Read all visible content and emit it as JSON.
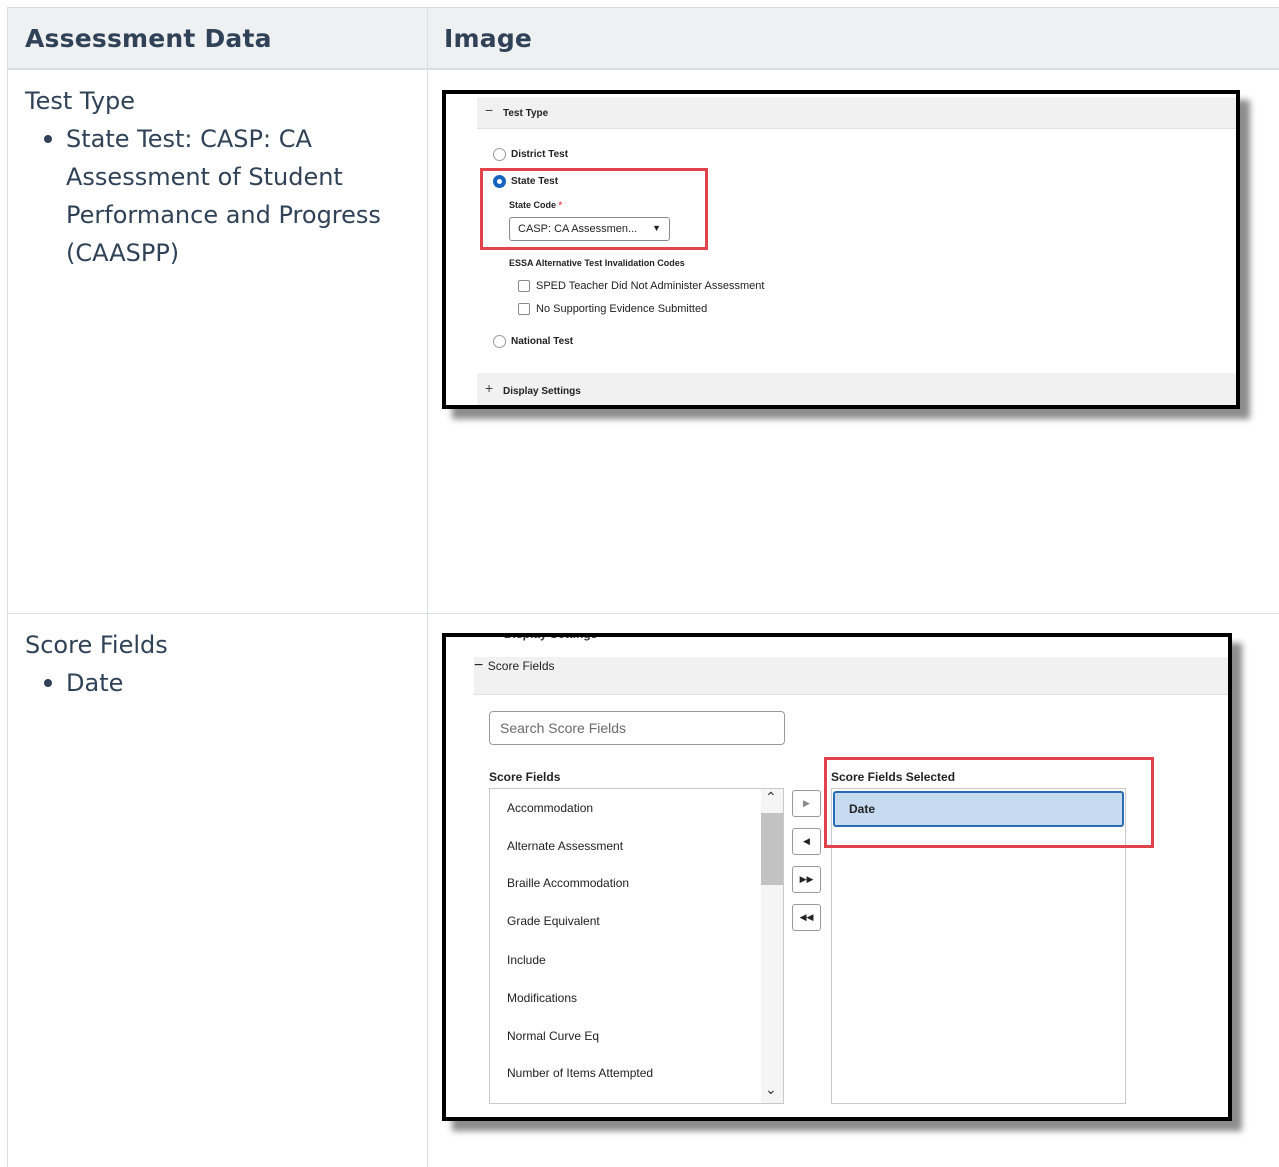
{
  "table": {
    "headers": {
      "col1": "Assessment Data",
      "col2": "Image"
    },
    "rows": [
      {
        "title": "Test Type",
        "bullets": [
          "State Test: CASP: CA Assessment of Student Performance and Progress (CAASPP)"
        ]
      },
      {
        "title": "Score Fields",
        "bullets": [
          "Date"
        ]
      }
    ]
  },
  "shot1": {
    "section_title": "Test Type",
    "radio_district": "District Test",
    "radio_state": "State Test",
    "state_code_label": "State Code",
    "required_mark": "*",
    "state_code_value": "CASP: CA Assessmen...",
    "essa_heading": "ESSA Alternative Test Invalidation Codes",
    "check_sped": "SPED Teacher Did Not Administer Assessment",
    "check_evidence": "No Supporting Evidence Submitted",
    "radio_national": "National Test",
    "display_settings": "Display Settings",
    "accent_color": "#1464c0",
    "highlight_color": "#e0434c"
  },
  "shot2": {
    "cut_text": "Display Settings",
    "section_title": "Score Fields",
    "search_placeholder": "Search Score Fields",
    "fields_title": "Score Fields",
    "selected_title": "Score Fields Selected",
    "fields": [
      "Accommodation",
      "Alternate Assessment",
      "Braille Accommodation",
      "Grade Equivalent",
      "Include",
      "Modifications",
      "Normal Curve Eq",
      "Number of Items Attempted"
    ],
    "selected": [
      "Date"
    ],
    "buttons": {
      "move_right": "▶",
      "move_left": "◀",
      "move_all_right": "▶▶",
      "move_all_left": "◀◀"
    }
  }
}
